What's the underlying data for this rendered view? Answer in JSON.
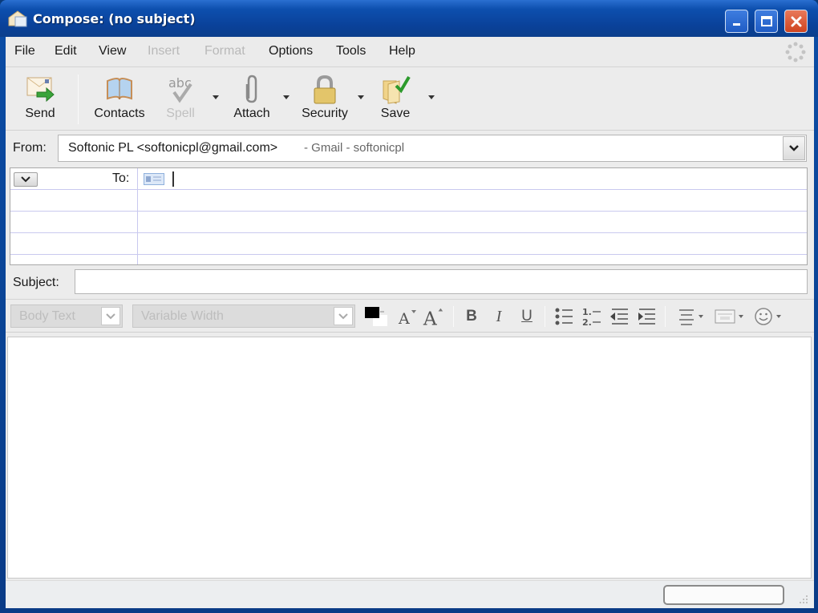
{
  "window": {
    "title": "Compose: (no subject)",
    "controls": {
      "minimize": "minimize",
      "maximize": "maximize",
      "close": "close"
    },
    "colors": {
      "titlebar": "#0d4fae",
      "close_button": "#d9512c",
      "client_bg": "#ececec"
    }
  },
  "menubar": {
    "items": [
      {
        "label": "File",
        "enabled": true
      },
      {
        "label": "Edit",
        "enabled": true
      },
      {
        "label": "View",
        "enabled": true
      },
      {
        "label": "Insert",
        "enabled": false
      },
      {
        "label": "Format",
        "enabled": false
      },
      {
        "label": "Options",
        "enabled": true
      },
      {
        "label": "Tools",
        "enabled": true
      },
      {
        "label": "Help",
        "enabled": true
      }
    ]
  },
  "toolbar": {
    "send": {
      "label": "Send",
      "icon": "send-icon"
    },
    "contacts": {
      "label": "Contacts",
      "icon": "address-book-icon"
    },
    "spell": {
      "label": "Spell",
      "icon": "spellcheck-icon",
      "enabled": false
    },
    "attach": {
      "label": "Attach",
      "icon": "paperclip-icon"
    },
    "security": {
      "label": "Security",
      "icon": "padlock-icon"
    },
    "save": {
      "label": "Save",
      "icon": "save-folder-icon"
    }
  },
  "header": {
    "from_label": "From:",
    "from_value": "Softonic PL <softonicpl@gmail.com>",
    "from_account": "- Gmail - softonicpl",
    "to_label": "To:",
    "to_value": "",
    "subject_label": "Subject:",
    "subject_value": ""
  },
  "format_toolbar": {
    "paragraph_style": "Body Text",
    "font": "Variable Width",
    "buttons": {
      "text_color": "text-color",
      "smaller": "smaller-font",
      "larger": "larger-font",
      "bold": "B",
      "italic": "I",
      "underline": "U",
      "bullets": "bulleted-list",
      "numbers": "numbered-list",
      "outdent": "outdent",
      "indent": "indent",
      "align": "align",
      "insert": "insert-object",
      "smiley": "smiley"
    }
  },
  "body": {
    "text": ""
  },
  "statusbar": {
    "text": ""
  }
}
